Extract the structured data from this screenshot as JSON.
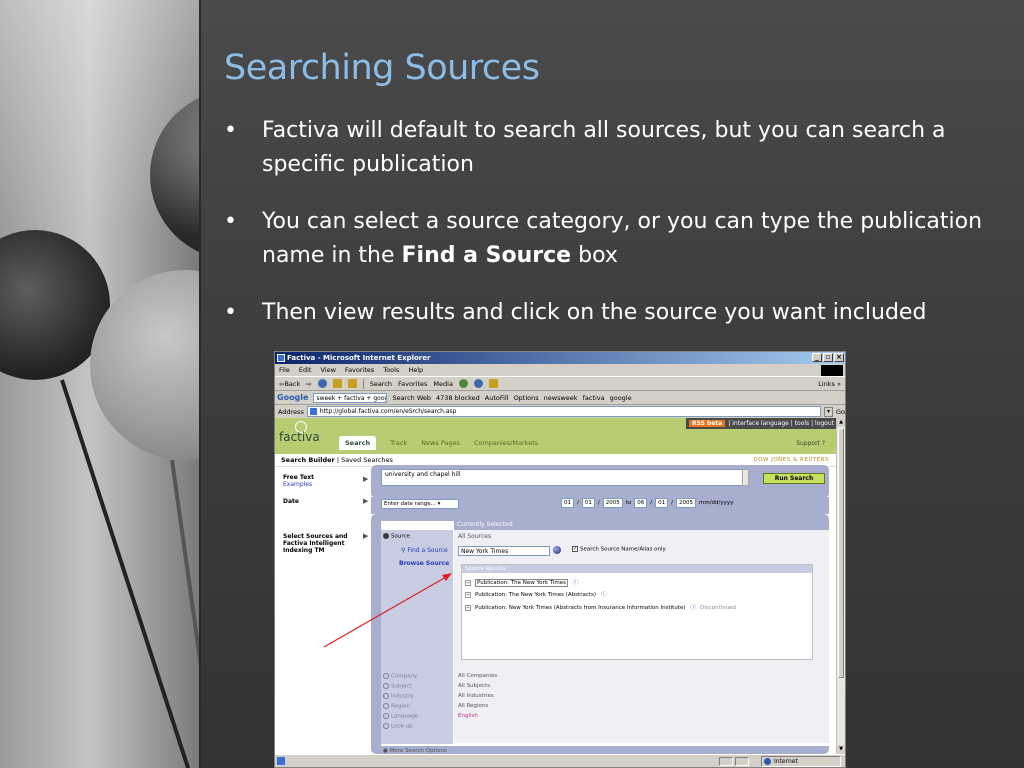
{
  "slide": {
    "title": "Searching Sources",
    "bullets": [
      {
        "text": "Factiva will default to search all sources, but you can search a specific publication"
      },
      {
        "pre": "You can select a source category, or you can type the publication name in the ",
        "bold": "Find a Source",
        "post": " box"
      },
      {
        "text": "Then view results and click on the source you want included"
      }
    ],
    "bullet_glyph": "•",
    "colors": {
      "title": "#8cbde6",
      "text": "#ffffff",
      "arrow": "#e02020"
    }
  },
  "browser": {
    "window_title": "Factiva - Microsoft Internet Explorer",
    "window_buttons": [
      "_",
      "▫",
      "×"
    ],
    "menu": [
      "File",
      "Edit",
      "View",
      "Favorites",
      "Tools",
      "Help"
    ],
    "toolbar": {
      "back": "⇦Back",
      "fwd": "⇨",
      "search": "Search",
      "favorites": "Favorites",
      "media": "Media",
      "links": "Links »"
    },
    "google_bar": {
      "logo": "Google",
      "query": "sweek + factiva + google",
      "search_web": "Search Web",
      "blocked": "4738 blocked",
      "autofill": "AutoFill",
      "options": "Options",
      "links": [
        "newsweek",
        "factiva",
        "google"
      ]
    },
    "address": {
      "label": "Address",
      "url": "http://global.factiva.com/en/eSrch/search.asp",
      "go": "Go"
    },
    "status": {
      "zone": "Internet"
    }
  },
  "factiva": {
    "toplinks": {
      "rss": "RSS beta",
      "rest": "| interface language | tools | logout"
    },
    "logo": "factiva",
    "tabs": [
      "Search",
      "Track",
      "News Pages",
      "Companies/Markets"
    ],
    "support": "Support ?",
    "subnav": {
      "builder": "Search Builder",
      "saved": "Saved Searches",
      "brand": "DOW JONES & REUTERS"
    },
    "free_text": {
      "label": "Free Text",
      "sub": "Examples",
      "value": "university and chapel hill"
    },
    "run_search": "Run Search",
    "date": {
      "label": "Date",
      "select": "Enter date range...",
      "from": [
        "01",
        "01",
        "2005"
      ],
      "to_word": "to",
      "to": [
        "06",
        "01",
        "2005"
      ],
      "format": "mm/dd/yyyy"
    },
    "sources": {
      "label": "Select Sources and Factiva Intelligent Indexing TM",
      "currently_selected": "Currently Selected",
      "source_nav": "Source",
      "all_sources": "All Sources",
      "find_label": "Find a Source",
      "find_value": "New York Times",
      "alias_label": "Search Source Name/Alias only",
      "alias_checked": "✓",
      "browse": "Browse Source",
      "results_head": "Source Results",
      "results": [
        {
          "text": "Publication: The New York Times",
          "boxed": true,
          "info": "ⓘ",
          "extra": ""
        },
        {
          "text": "Publication: The New York Times (Abstracts)",
          "boxed": false,
          "info": "ⓘ",
          "extra": ""
        },
        {
          "text": "Publication: New York Times (Abstracts from Insurance Information Institute)",
          "boxed": false,
          "info": "ⓘ",
          "extra": "Discontinued"
        }
      ]
    },
    "categories": [
      {
        "name": "Company",
        "value": "All Companies"
      },
      {
        "name": "Subject",
        "value": "All Subjects"
      },
      {
        "name": "Industry",
        "value": "All Industries"
      },
      {
        "name": "Region",
        "value": "All Regions"
      },
      {
        "name": "Language",
        "value": "English"
      },
      {
        "name": "Look up",
        "value": ""
      }
    ],
    "more_options": "More Search Options"
  }
}
